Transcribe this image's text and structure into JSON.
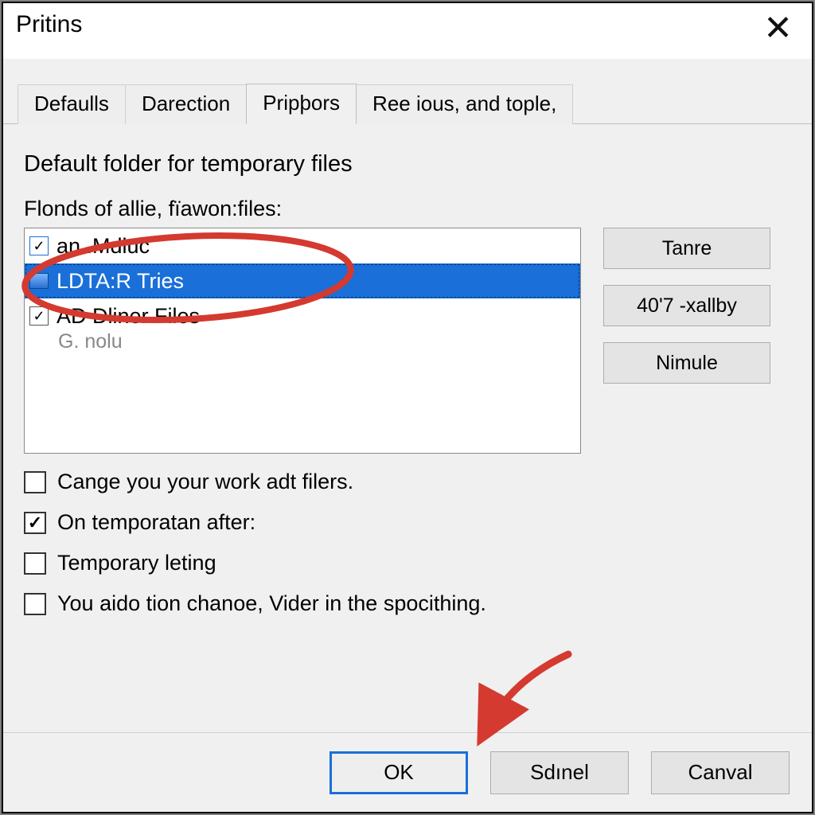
{
  "accent_color": "#1a6fd8",
  "annotation_color": "#d43a2f",
  "window": {
    "title": "Pritins"
  },
  "tabs": [
    {
      "label": "Defaulls",
      "active": false
    },
    {
      "label": "Darection",
      "active": false
    },
    {
      "label": "Pripþors",
      "active": true
    },
    {
      "label": "Ree ious, and tople,",
      "active": false
    }
  ],
  "section": {
    "heading": "Default folder for temporary files",
    "list_label": "Flonds of allie, fïawon:files:",
    "items": [
      {
        "label": "an..Mdluc",
        "checked": true,
        "selected": false
      },
      {
        "label": "LDTA:R Tries",
        "checked": false,
        "selected": true,
        "icon": "computer"
      },
      {
        "label": "AD Dliner Files",
        "checked": true,
        "selected": false
      }
    ],
    "extra_line": "G. nolu"
  },
  "side_buttons": [
    {
      "label": "Tanre"
    },
    {
      "label": "40'7 -xallby"
    },
    {
      "label": "Nimule"
    }
  ],
  "checkboxes": [
    {
      "label": "Cange you your work adt filers.",
      "checked": false
    },
    {
      "label": "On temporatan after:",
      "checked": true
    },
    {
      "label": "Temporary leting",
      "checked": false
    },
    {
      "label": "You aido tion chanoe, Vider in the spocithing.",
      "checked": false
    }
  ],
  "footer": {
    "ok": "OK",
    "sdmel": "Sdınel",
    "cancel": "Canval"
  }
}
